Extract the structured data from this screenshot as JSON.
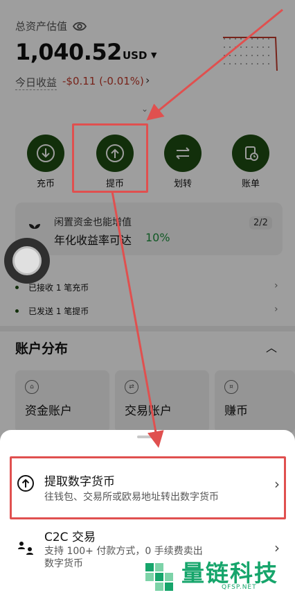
{
  "header": {
    "asset_label": "总资产估值",
    "asset_value": "1,040.52",
    "asset_unit": "USD",
    "today_label": "今日收益",
    "today_value": "-$0.11 (-0.01%)"
  },
  "actions": [
    {
      "label": "充币",
      "icon": "download-circle-icon"
    },
    {
      "label": "提币",
      "icon": "upload-circle-icon"
    },
    {
      "label": "划转",
      "icon": "swap-arrows-icon"
    },
    {
      "label": "账单",
      "icon": "bill-clock-icon"
    }
  ],
  "promo": {
    "title": "闲置资金也能增值",
    "subtitle": "年化收益率可达",
    "rate": "10%",
    "page": "2/2"
  },
  "notices": [
    {
      "text": "已接收 1 笔充币"
    },
    {
      "text": "已发送 1 笔提币"
    }
  ],
  "section": {
    "title": "账户分布"
  },
  "accounts": [
    {
      "label": "资金账户"
    },
    {
      "label": "交易账户"
    },
    {
      "label": "赚币"
    }
  ],
  "sheet": {
    "options": [
      {
        "title": "提取数字货币",
        "desc": "往钱包、交易所或欧易地址转出数字货币"
      },
      {
        "title": "C2C 交易",
        "desc": "支持 100+ 付款方式，0 手续费卖出数字货币"
      }
    ]
  },
  "watermark": {
    "text": "量链科技",
    "sub": "QFSP.NET"
  },
  "colors": {
    "accent": "#1e4d12",
    "negative": "#c0392b",
    "positive": "#1a8f3a",
    "annotation": "#e0504f",
    "watermark": "#16a56b"
  }
}
